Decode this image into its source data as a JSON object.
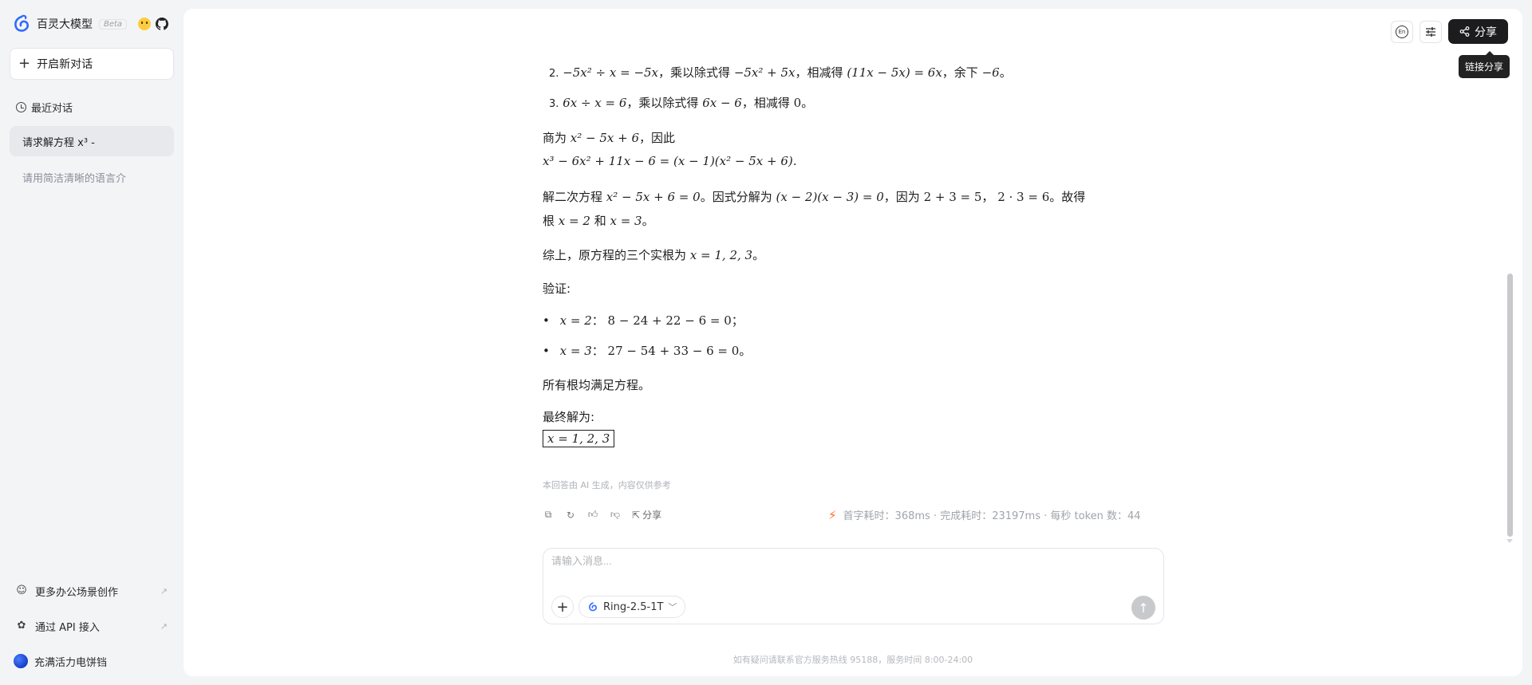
{
  "app": {
    "brand_title": "百灵大模型",
    "beta_label": "Beta"
  },
  "sidebar": {
    "new_chat_label": "开启新对话",
    "recent_label": "最近对话",
    "conversations": [
      {
        "label": "请求解方程 x³ -"
      },
      {
        "label": "请用简洁清晰的语言介"
      }
    ],
    "bottom": [
      {
        "label": "更多办公场景创作",
        "icon": "robot-icon"
      },
      {
        "label": "通过 API 接入",
        "icon": "api-icon"
      }
    ],
    "user_name": "充满活力电饼铛"
  },
  "header": {
    "language_icon_text": "En",
    "share_label": "分享",
    "tooltip": "链接分享"
  },
  "message": {
    "step2_num": "2.",
    "step2_a": "−5x² ÷ x = −5x",
    "step2_b": "，乘以除式得",
    "step2_c": "−5x² + 5x",
    "step2_d": "，相减得",
    "step2_e": "(11x − 5x) = 6x",
    "step2_f": "，余下",
    "step2_g": "−6",
    "step2_h": "。",
    "step3_num": "3.",
    "step3_a": "6x ÷ x = 6",
    "step3_b": "，乘以除式得",
    "step3_c": "6x − 6",
    "step3_d": "，相减得",
    "step3_e": "0",
    "step3_f": "。",
    "quotient_a": "商为",
    "quotient_b": "x² − 5x + 6",
    "quotient_c": "，因此",
    "factored": "x³ − 6x² + 11x − 6 = (x − 1)(x² − 5x + 6).",
    "quad_a": "解二次方程",
    "quad_b": "x² − 5x + 6 = 0",
    "quad_c": "。因式分解为",
    "quad_d": "(x − 2)(x − 3) = 0",
    "quad_e": "，因为",
    "quad_f": "2 + 3 = 5",
    "quad_g": "，",
    "quad_h": "2 · 3 = 6",
    "quad_i": "。故得",
    "roots_a": "根",
    "roots_b": "x = 2",
    "roots_c": "和",
    "roots_d": "x = 3",
    "roots_e": "。",
    "summary_a": "综上，原方程的三个实根为",
    "summary_b": "x = 1, 2, 3",
    "summary_c": "。",
    "verify_label": "验证:",
    "verify1_a": "x = 2",
    "verify1_b": "：",
    "verify1_c": "8 − 24 + 22 − 6 = 0",
    "verify1_d": "；",
    "verify2_a": "x = 3",
    "verify2_b": "：",
    "verify2_c": "27 − 54 + 33 − 6 = 0",
    "verify2_d": "。",
    "all_roots": "所有根均满足方程。",
    "final_label": "最终解为:",
    "final_answer": "x = 1, 2, 3",
    "disclaimer": "本回答由 AI 生成，内容仅供参考",
    "share_label": "分享",
    "stats": "首字耗时：368ms · 完成耗时：23197ms · 每秒 token 数：44"
  },
  "composer": {
    "placeholder": "请输入消息...",
    "model": "Ring-2.5-1T"
  },
  "footer": "如有疑问请联系官方服务热线 95188，服务时间 8:00-24:00"
}
